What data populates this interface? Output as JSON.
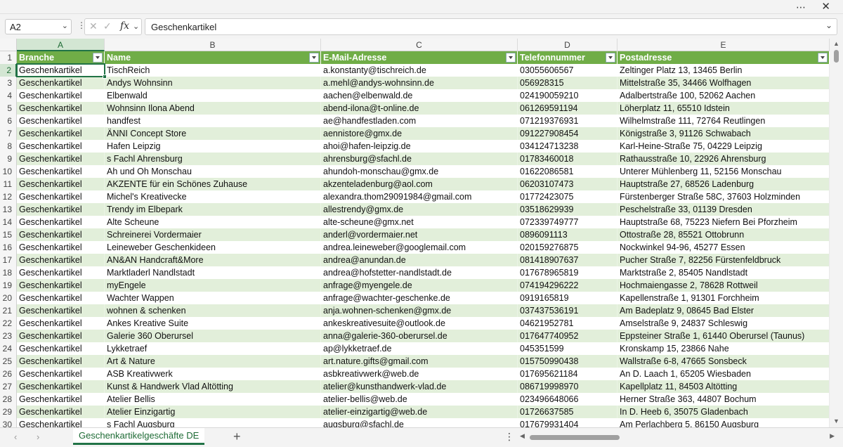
{
  "window": {
    "more_icon": "⋯",
    "close_icon": "✕"
  },
  "formula_bar": {
    "name_box": "A2",
    "cancel_icon": "✕",
    "enter_icon": "✓",
    "fx_label": "fx",
    "value": "Geschenkartikel"
  },
  "columns": [
    "A",
    "B",
    "C",
    "D",
    "E"
  ],
  "selected_column": "A",
  "selected_row": 2,
  "table_header": {
    "row_number": 1,
    "cells": [
      "Branche",
      "Name",
      "E-Mail-Adresse",
      "Telefonnummer",
      "Postadresse"
    ]
  },
  "rows": [
    {
      "n": 2,
      "cells": [
        "Geschenkartikel",
        "TischReich",
        "a.konstanty@tischreich.de",
        "03055606567",
        "Zeltinger Platz 13, 13465 Berlin"
      ]
    },
    {
      "n": 3,
      "cells": [
        "Geschenkartikel",
        "Andys Wohnsinn",
        "a.mehl@andys-wohnsinn.de",
        "056928315",
        "Mittelstraße 35, 34466 Wolfhagen"
      ]
    },
    {
      "n": 4,
      "cells": [
        "Geschenkartikel",
        "Elbenwald",
        "aachen@elbenwald.de",
        "024190059210",
        "Adalbertstraße 100, 52062 Aachen"
      ]
    },
    {
      "n": 5,
      "cells": [
        "Geschenkartikel",
        "Wohnsinn Ilona Abend",
        "abend-ilona@t-online.de",
        "061269591194",
        "Löherplatz 11, 65510 Idstein"
      ]
    },
    {
      "n": 6,
      "cells": [
        "Geschenkartikel",
        "handfest",
        "ae@handfestladen.com",
        "071219376931",
        "Wilhelmstraße 111, 72764 Reutlingen"
      ]
    },
    {
      "n": 7,
      "cells": [
        "Geschenkartikel",
        "ÄNNI Concept Store",
        "aennistore@gmx.de",
        "091227908454",
        "Königstraße 3, 91126 Schwabach"
      ]
    },
    {
      "n": 8,
      "cells": [
        "Geschenkartikel",
        "Hafen Leipzig",
        "ahoi@hafen-leipzig.de",
        "034124713238",
        "Karl-Heine-Straße 75, 04229 Leipzig"
      ]
    },
    {
      "n": 9,
      "cells": [
        "Geschenkartikel",
        "s Fachl Ahrensburg",
        "ahrensburg@sfachl.de",
        "01783460018",
        "Rathausstraße 10, 22926 Ahrensburg"
      ]
    },
    {
      "n": 10,
      "cells": [
        "Geschenkartikel",
        "Ah und Oh Monschau",
        "ahundoh-monschau@gmx.de",
        "01622086581",
        "Unterer Mühlenberg 11, 52156 Monschau"
      ]
    },
    {
      "n": 11,
      "cells": [
        "Geschenkartikel",
        "AKZENTE für ein Schönes Zuhause",
        "akzenteladenburg@aol.com",
        "06203107473",
        "Hauptstraße 27, 68526 Ladenburg"
      ]
    },
    {
      "n": 12,
      "cells": [
        "Geschenkartikel",
        "Michel's Kreativecke",
        "alexandra.thom29091984@gmail.com",
        "01772423075",
        "Fürstenberger Straße 58C, 37603 Holzminden"
      ]
    },
    {
      "n": 13,
      "cells": [
        "Geschenkartikel",
        "Trendy im Elbepark",
        "allestrendy@gmx.de",
        "03518629939",
        "Peschelstraße 33, 01139 Dresden"
      ]
    },
    {
      "n": 14,
      "cells": [
        "Geschenkartikel",
        "Alte Scheune",
        "alte-scheune@gmx.net",
        "072339749777",
        "Hauptstraße 68, 75223 Niefern Bei Pforzheim"
      ]
    },
    {
      "n": 15,
      "cells": [
        "Geschenkartikel",
        "Schreinerei Vordermaier",
        "anderl@vordermaier.net",
        "0896091113",
        "Ottostraße 28, 85521 Ottobrunn"
      ]
    },
    {
      "n": 16,
      "cells": [
        "Geschenkartikel",
        "Leineweber Geschenkideen",
        "andrea.leineweber@googlemail.com",
        "020159276875",
        "Nockwinkel 94-96, 45277 Essen"
      ]
    },
    {
      "n": 17,
      "cells": [
        "Geschenkartikel",
        "AN&AN Handcraft&More",
        "andrea@anundan.de",
        "081418907637",
        "Pucher Straße 7, 82256 Fürstenfeldbruck"
      ]
    },
    {
      "n": 18,
      "cells": [
        "Geschenkartikel",
        "Marktladerl Nandlstadt",
        "andrea@hofstetter-nandlstadt.de",
        "017678965819",
        "Marktstraße 2, 85405 Nandlstadt"
      ]
    },
    {
      "n": 19,
      "cells": [
        "Geschenkartikel",
        "myEngele",
        "anfrage@myengele.de",
        "074194296222",
        "Hochmaiengasse 2, 78628 Rottweil"
      ]
    },
    {
      "n": 20,
      "cells": [
        "Geschenkartikel",
        "Wachter Wappen",
        "anfrage@wachter-geschenke.de",
        "0919165819",
        "Kapellenstraße 1, 91301 Forchheim"
      ]
    },
    {
      "n": 21,
      "cells": [
        "Geschenkartikel",
        "wohnen & schenken",
        "anja.wohnen-schenken@gmx.de",
        "037437536191",
        "Am Badeplatz 9, 08645 Bad Elster"
      ]
    },
    {
      "n": 22,
      "cells": [
        "Geschenkartikel",
        "Ankes Kreative Suite",
        "ankeskreativesuite@outlook.de",
        "04621952781",
        "Amselstraße 9, 24837 Schleswig"
      ]
    },
    {
      "n": 23,
      "cells": [
        "Geschenkartikel",
        "Galerie 360 Oberursel",
        "anna@galerie-360-oberursel.de",
        "017647740952",
        "Eppsteiner Straße 1, 61440 Oberursel (Taunus)"
      ]
    },
    {
      "n": 24,
      "cells": [
        "Geschenkartikel",
        "Lykketraef",
        "ap@lykketraef.de",
        "045351599",
        "Kronskamp 15, 23866 Nahe"
      ]
    },
    {
      "n": 25,
      "cells": [
        "Geschenkartikel",
        "Art & Nature",
        "art.nature.gifts@gmail.com",
        "015750990438",
        "Wallstraße 6-8, 47665 Sonsbeck"
      ]
    },
    {
      "n": 26,
      "cells": [
        "Geschenkartikel",
        "ASB Kreativwerk",
        "asbkreativwerk@web.de",
        "017695621184",
        "An D. Laach 1, 65205 Wiesbaden"
      ]
    },
    {
      "n": 27,
      "cells": [
        "Geschenkartikel",
        "Kunst & Handwerk Vlad Altötting",
        "atelier@kunsthandwerk-vlad.de",
        "086719998970",
        "Kapellplatz 11, 84503 Altötting"
      ]
    },
    {
      "n": 28,
      "cells": [
        "Geschenkartikel",
        "Atelier Bellis",
        "atelier-bellis@web.de",
        "023496648066",
        "Herner Straße 363, 44807 Bochum"
      ]
    },
    {
      "n": 29,
      "cells": [
        "Geschenkartikel",
        "Atelier Einzigartig",
        "atelier-einzigartig@web.de",
        "01726637585",
        "In D. Heeb 6, 35075 Gladenbach"
      ]
    },
    {
      "n": 30,
      "cells": [
        "Geschenkartikel",
        "s Fachl Augsburg",
        "augsburg@sfachl.de",
        "017679931404",
        "Am Perlachberg 5, 86150 Augsburg"
      ]
    }
  ],
  "sheet_tab": "Geschenkartikelgeschäfte DE",
  "status": {
    "prev_icon": "‹",
    "next_icon": "›",
    "add_icon": "+",
    "more_icon": "⋮"
  },
  "colors": {
    "header_green": "#70ad47",
    "band_green": "#e2efda",
    "accent": "#217346"
  }
}
